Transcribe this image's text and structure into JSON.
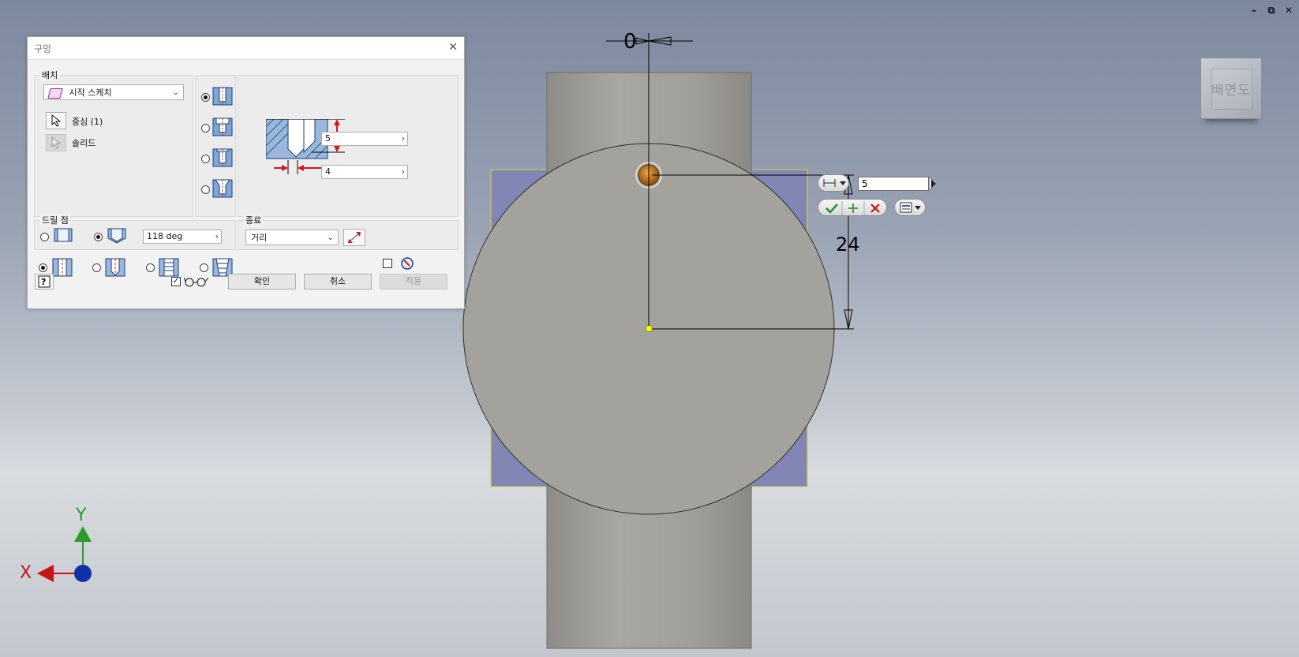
{
  "window_controls": {
    "minimize": "–",
    "restore": "⧉",
    "close": "✕"
  },
  "viewcube": {
    "label": "배면도"
  },
  "dialog": {
    "title": "구멍",
    "placement": {
      "group_label": "배치",
      "selected": "시작 스케치",
      "center_label": "중심 (1)",
      "solid_label": "솔리드"
    },
    "dimensions": {
      "depth_value": "5",
      "diameter_value": "4"
    },
    "drill_point": {
      "group_label": "드릴 점",
      "angle_value": "118 deg"
    },
    "termination": {
      "group_label": "종료",
      "selected": "거리"
    },
    "buttons": {
      "ok": "확인",
      "cancel": "취소",
      "apply": "적용"
    }
  },
  "sketch": {
    "dim_top": "0",
    "dim_vertical": "24",
    "inline_value": "5"
  },
  "axes": {
    "x": "X",
    "y": "Y"
  },
  "colors": {
    "part_gray": "#a3a29d",
    "sketch_blue": "#8186b4",
    "red_arrow": "#d9141b",
    "axis_green": "#2a9d2a",
    "axis_blue": "#1030a8",
    "axis_red": "#c81414"
  }
}
